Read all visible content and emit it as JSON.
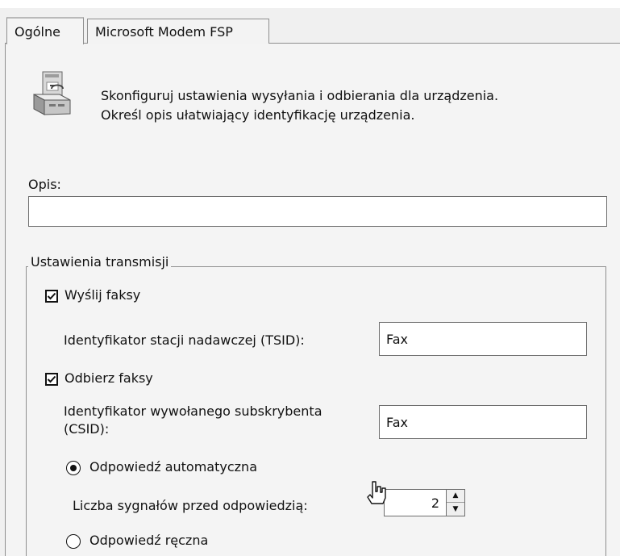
{
  "tabs": [
    {
      "label": "Ogólne"
    },
    {
      "label": "Microsoft Modem FSP"
    }
  ],
  "header": {
    "icon": "device-settings-icon",
    "line1": "Skonfiguruj ustawienia wysyłania i odbierania dla urządzenia.",
    "line2": "Określ opis ułatwiający identyfikację urządzenia."
  },
  "description": {
    "label": "Opis:",
    "value": ""
  },
  "transmission": {
    "title": "Ustawienia transmisji",
    "send_fax": {
      "label": "Wyślij faksy",
      "checked": true
    },
    "tsid_label": "Identyfikator stacji nadawczej (TSID):",
    "tsid_value": "Fax",
    "receive_fax": {
      "label": "Odbierz faksy",
      "checked": true
    },
    "csid_label_line1": "Identyfikator wywołanego subskrybenta",
    "csid_label_line2": "(CSID):",
    "csid_value": "Fax",
    "auto_answer": {
      "label": "Odpowiedź automatyczna",
      "selected": true
    },
    "rings_label": "Liczba sygnałów przed odpowiedzią:",
    "rings_value": "2",
    "manual_answer": {
      "label": "Odpowiedź ręczna",
      "selected": false
    }
  },
  "icons": {
    "check": "checkmark-icon",
    "cursor": "hand-cursor-icon",
    "spin_up": "spin-up-icon",
    "spin_down": "spin-down-icon"
  }
}
